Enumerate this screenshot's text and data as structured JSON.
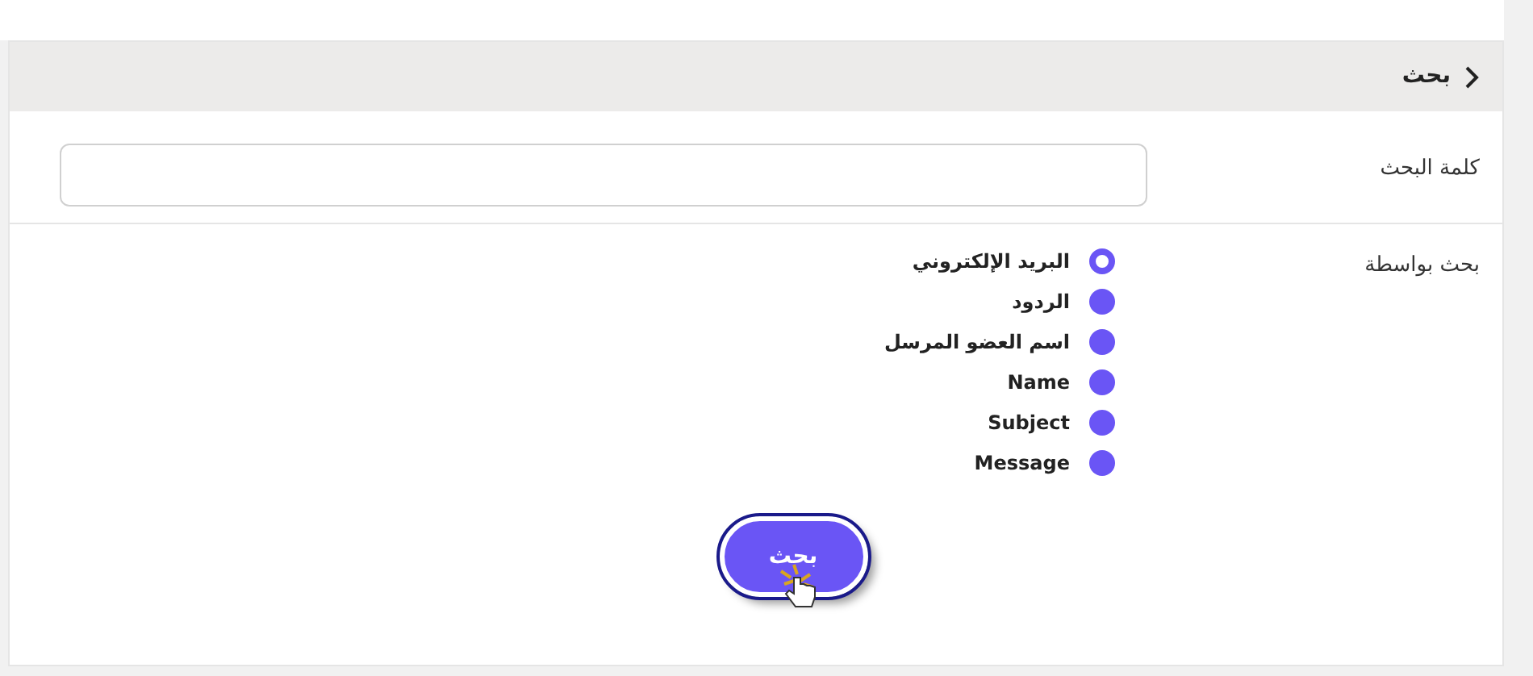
{
  "header": {
    "title": "بحث"
  },
  "keyword": {
    "label": "كلمة البحث"
  },
  "search_by": {
    "label": "بحث بواسطة",
    "options": [
      {
        "label": "البريد الإلكتروني",
        "selected": true
      },
      {
        "label": "الردود",
        "selected": false
      },
      {
        "label": "اسم العضو المرسل",
        "selected": false
      },
      {
        "label": "Name",
        "selected": false
      },
      {
        "label": "Subject",
        "selected": false
      },
      {
        "label": "Message",
        "selected": false
      }
    ]
  },
  "submit": {
    "label": "بحث"
  }
}
